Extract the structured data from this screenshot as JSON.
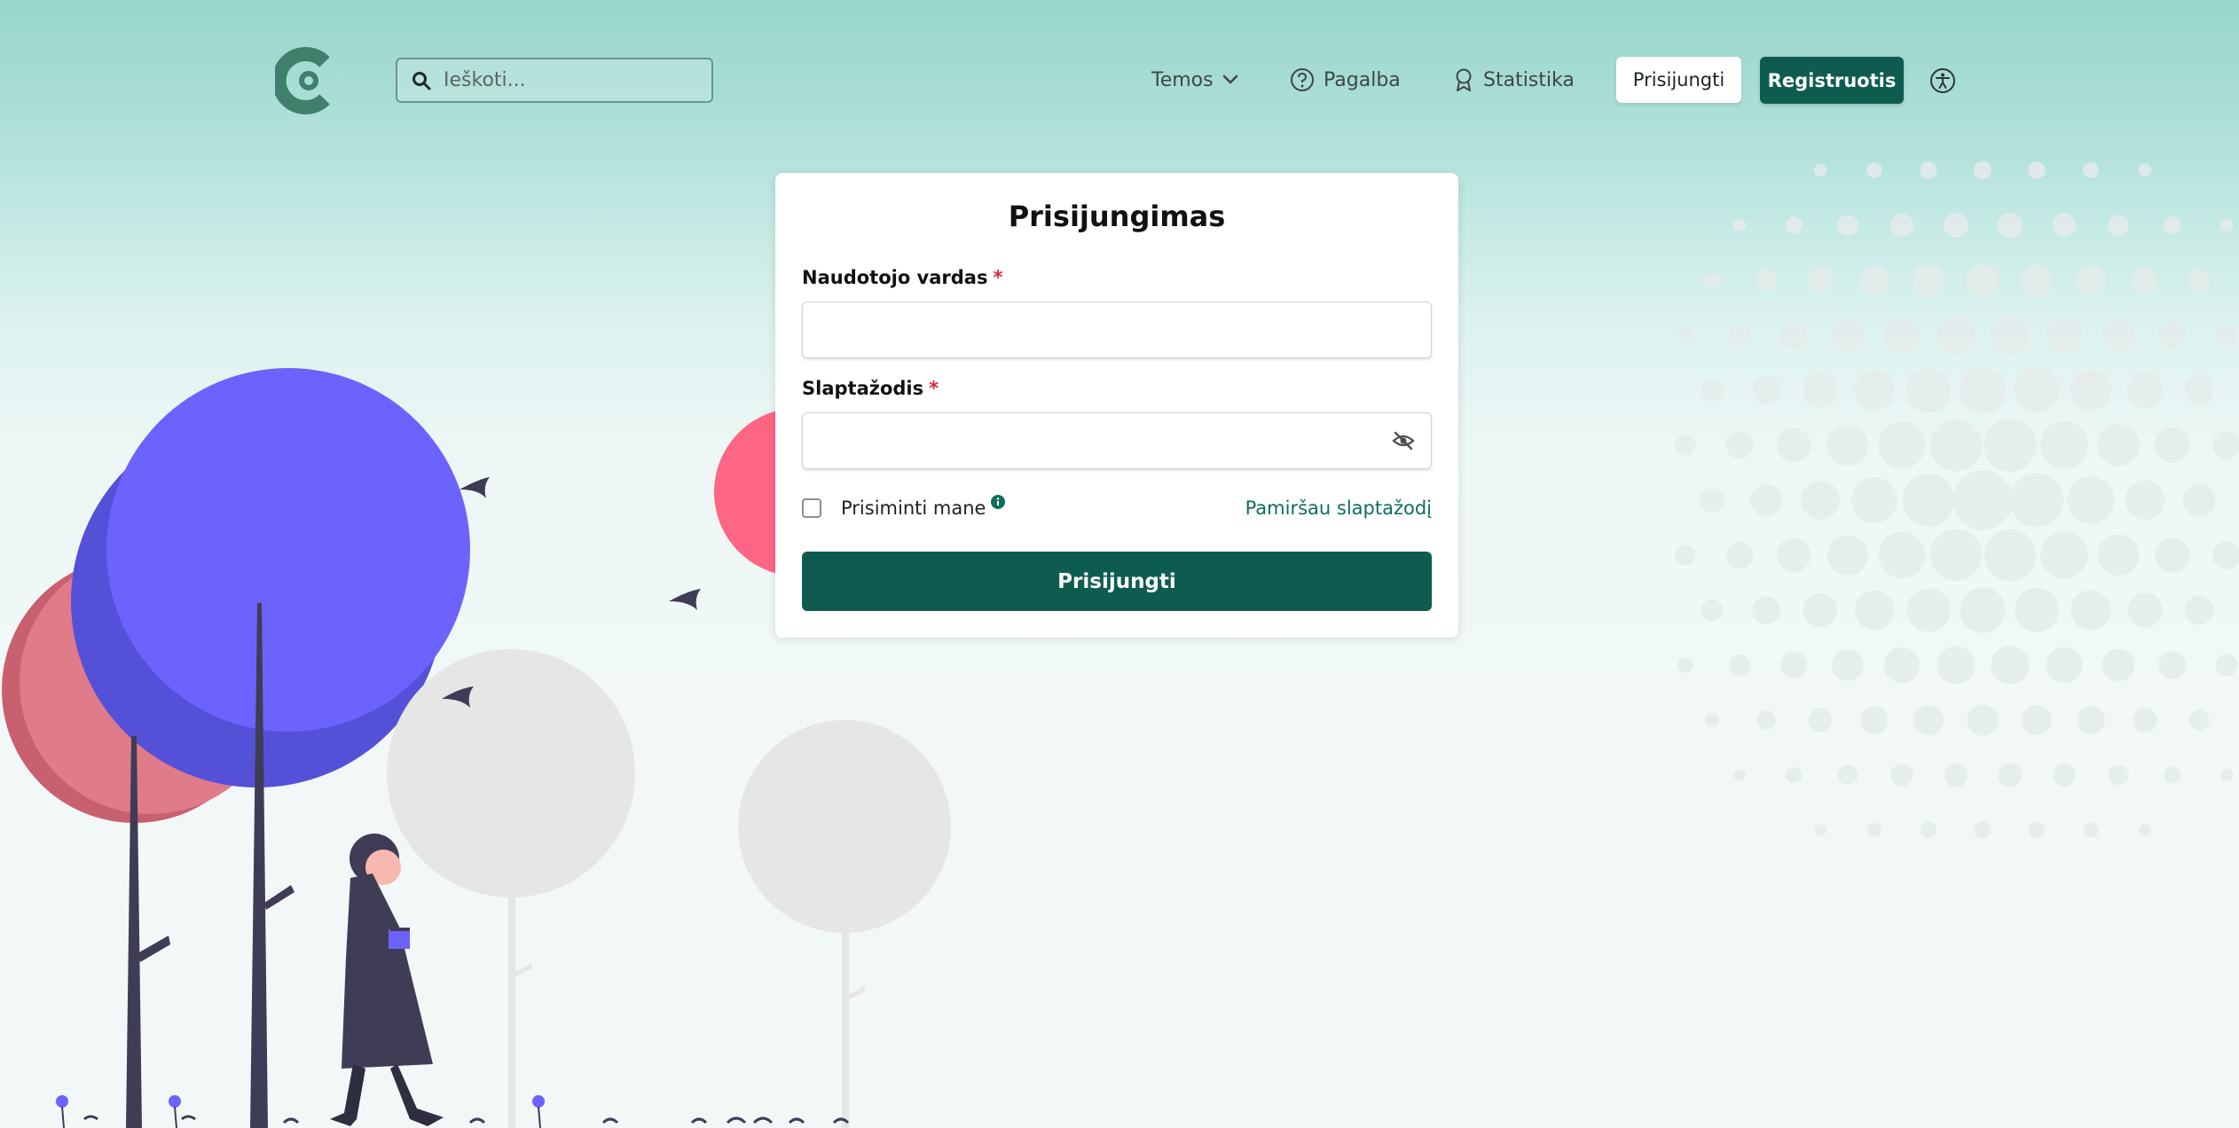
{
  "header": {
    "search_placeholder": "Ieškoti...",
    "nav": {
      "temos": "Temos",
      "pagalba": "Pagalba",
      "statistika": "Statistika"
    },
    "login_button": "Prisijungti",
    "register_button": "Registruotis"
  },
  "login_form": {
    "title": "Prisijungimas",
    "username_label": "Naudotojo vardas",
    "password_label": "Slaptažodis",
    "required_marker": "*",
    "username_value": "",
    "password_value": "",
    "remember_label": "Prisiminti mane",
    "remember_checked": false,
    "forgot_link": "Pamiršau slaptažodį",
    "submit_button": "Prisijungti"
  },
  "icons": {
    "logo": "app-logo",
    "search": "search-icon",
    "chevron": "chevron-down-icon",
    "help": "question-circle-icon",
    "stats": "award-icon",
    "accessibility": "accessibility-icon",
    "password_toggle": "eye-slash-icon",
    "info": "info-icon"
  },
  "colors": {
    "primary": "#0e5c4f",
    "link": "#0e6e5d",
    "required": "#d9263a"
  }
}
